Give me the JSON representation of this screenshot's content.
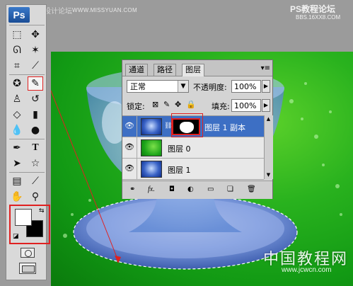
{
  "watermark": {
    "top": "思缘设计论坛",
    "top_url": "WWW.MISSYUAN.COM",
    "right": "PS教程论坛",
    "right_url": "BBS.16XX8.COM",
    "bottom": "中国教程网",
    "bottom_url": "www.jcwcn.com"
  },
  "toolbox": {
    "logo": "Ps",
    "tools": [
      "marquee-icon",
      "move-icon",
      "lasso-icon",
      "magic-wand-icon",
      "crop-icon",
      "eyedropper-icon",
      "healing-icon",
      "brush-icon",
      "stamp-icon",
      "history-brush-icon",
      "eraser-icon",
      "gradient-icon",
      "blur-icon",
      "dodge-icon",
      "pen-icon",
      "type-icon",
      "path-select-icon",
      "shape-icon",
      "notes-icon",
      "eyedropper-2-icon",
      "hand-icon",
      "zoom-icon"
    ],
    "active_tool": "brush-icon",
    "foreground_color": "#ffffff",
    "background_color": "#000000",
    "swap_glyph": "⇆",
    "default_glyph": "◪"
  },
  "layers_panel": {
    "tabs": [
      "通道",
      "路径",
      "图层"
    ],
    "active_tab": "图层",
    "menu_glyph": "▾≡",
    "blend_mode": "正常",
    "opacity_label": "不透明度:",
    "opacity_value": "100%",
    "lock_label": "锁定:",
    "fill_label": "填充:",
    "fill_value": "100%",
    "layers": [
      {
        "name": "图层 1 副本",
        "selected": true,
        "has_mask": true
      },
      {
        "name": "图层 0",
        "selected": false,
        "has_mask": false
      },
      {
        "name": "图层 1",
        "selected": false,
        "has_mask": false
      }
    ],
    "footer_buttons": [
      "⚭",
      "fx.",
      "◘",
      "◐",
      "▭",
      "❏",
      "🗑"
    ]
  },
  "colors": {
    "selection_highlight": "#3d6fc4",
    "annotation_red": "#e02020"
  }
}
